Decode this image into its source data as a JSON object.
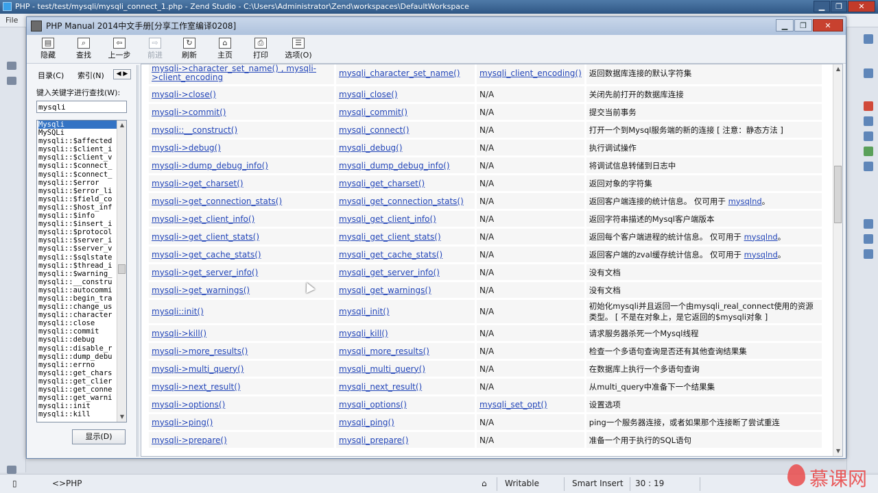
{
  "zend": {
    "title": "PHP - test/test/mysqli/mysqli_connect_1.php - Zend Studio - C:\\Users\\Administrator\\Zend\\workspaces\\DefaultWorkspace",
    "menu_first": "File",
    "status": {
      "editor": "PHP",
      "writable": "Writable",
      "insert_mode": "Smart Insert",
      "position": "30 : 19"
    }
  },
  "watermark": {
    "text": "慕课网"
  },
  "manual": {
    "title": "PHP Manual 2014中文手册[分享工作室编译0208]",
    "toolbar": [
      {
        "label": "隐藏",
        "icon": "hide-icon",
        "enabled": true
      },
      {
        "label": "查找",
        "icon": "find-icon",
        "enabled": true
      },
      {
        "label": "上一步",
        "icon": "back-icon",
        "enabled": true
      },
      {
        "label": "前进",
        "icon": "forward-icon",
        "enabled": false
      },
      {
        "label": "刷新",
        "icon": "refresh-icon",
        "enabled": true
      },
      {
        "label": "主页",
        "icon": "home-icon",
        "enabled": true
      },
      {
        "label": "打印",
        "icon": "print-icon",
        "enabled": true
      },
      {
        "label": "选项(O)",
        "icon": "options-icon",
        "enabled": true
      }
    ],
    "nav": {
      "tab_contents": "目录(C)",
      "tab_index": "索引(N)",
      "search_label": "键入关键字进行查找(W):",
      "search_value": "mysqli",
      "display_button": "显示(D)",
      "list": [
        "Mysqli",
        "MySQLi",
        "mysqli::$affected",
        "mysqli::$client_i",
        "mysqli::$client_v",
        "mysqli::$connect_",
        "mysqli::$connect_",
        "mysqli::$error",
        "mysqli::$error_li",
        "mysqli::$field_co",
        "mysqli::$host_inf",
        "mysqli::$info",
        "mysqli::$insert_i",
        "mysqli::$protocol",
        "mysqli::$server_i",
        "mysqli::$server_v",
        "mysqli::$sqlstate",
        "mysqli::$thread_i",
        "mysqli::$warning_",
        "mysqli::__constru",
        "mysqli::autocommi",
        "mysqli::begin_tra",
        "mysqli::change_us",
        "mysqli::character",
        "mysqli::close",
        "mysqli::commit",
        "mysqli::debug",
        "mysqli::disable_r",
        "mysqli::dump_debu",
        "mysqli::errno",
        "mysqli::get_chars",
        "mysqli::get_clier",
        "mysqli::get_conne",
        "mysqli::get_warni",
        "mysqli::init",
        "mysqli::kill"
      ]
    },
    "rows": [
      {
        "oop": "mysqli->character_set_name() , mysqli->client_encoding",
        "proc": "mysqli_character_set_name()",
        "alias": "mysqli_client_encoding()",
        "desc": "返回数据库连接的默认字符集",
        "tall": "first"
      },
      {
        "oop": "mysqli->close()",
        "proc": "mysqli_close()",
        "alias": "N/A",
        "desc": "关闭先前打开的数据库连接"
      },
      {
        "oop": "mysqli->commit()",
        "proc": "mysqli_commit()",
        "alias": "N/A",
        "desc": "提交当前事务"
      },
      {
        "oop": "mysqli::__construct()",
        "proc": "mysqli_connect()",
        "alias": "N/A",
        "desc": "打开一个到Mysql服务端的新的连接 [ 注意：静态方法 ]"
      },
      {
        "oop": "mysqli->debug()",
        "proc": "mysqli_debug()",
        "alias": "N/A",
        "desc": "执行调试操作"
      },
      {
        "oop": "mysqli->dump_debug_info()",
        "proc": "mysqli_dump_debug_info()",
        "alias": "N/A",
        "desc": "将调试信息转储到日志中"
      },
      {
        "oop": "mysqli->get_charset()",
        "proc": "mysqli_get_charset()",
        "alias": "N/A",
        "desc": "返回对象的字符集"
      },
      {
        "oop": "mysqli->get_connection_stats()",
        "proc": "mysqli_get_connection_stats()",
        "alias": "N/A",
        "desc": "返回客户端连接的统计信息。 仅可用于 ",
        "link": "mysqlnd",
        "after": "。"
      },
      {
        "oop": "mysqli->get_client_info()",
        "proc": "mysqli_get_client_info()",
        "alias": "N/A",
        "desc": "返回字符串描述的Mysql客户端版本"
      },
      {
        "oop": "mysqli->get_client_stats()",
        "proc": "mysqli_get_client_stats()",
        "alias": "N/A",
        "desc": "返回每个客户端进程的统计信息。 仅可用于 ",
        "link": "mysqlnd",
        "after": "。"
      },
      {
        "oop": "mysqli->get_cache_stats()",
        "proc": "mysqli_get_cache_stats()",
        "alias": "N/A",
        "desc": "返回客户端的zval缓存统计信息。 仅可用于 ",
        "link": "mysqlnd",
        "after": "。"
      },
      {
        "oop": "mysqli->get_server_info()",
        "proc": "mysqli_get_server_info()",
        "alias": "N/A",
        "desc": "没有文档"
      },
      {
        "oop": "mysqli->get_warnings()",
        "proc": "mysqli_get_warnings()",
        "alias": "N/A",
        "desc": "没有文档"
      },
      {
        "oop": "mysqli::init()",
        "proc": "mysqli_init()",
        "alias": "N/A",
        "desc": "初始化mysqli并且返回一个由mysqli_real_connect使用的资源类型。 [ 不是在对象上，是它返回的$mysqli对象 ]",
        "tall": "tall"
      },
      {
        "oop": "mysqli->kill()",
        "proc": "mysqli_kill()",
        "alias": "N/A",
        "desc": "请求服务器杀死一个Mysql线程"
      },
      {
        "oop": "mysqli->more_results()",
        "proc": "mysqli_more_results()",
        "alias": "N/A",
        "desc": "检查一个多语句查询是否还有其他查询结果集"
      },
      {
        "oop": "mysqli->multi_query()",
        "proc": "mysqli_multi_query()",
        "alias": "N/A",
        "desc": "在数据库上执行一个多语句查询"
      },
      {
        "oop": "mysqli->next_result()",
        "proc": "mysqli_next_result()",
        "alias": "N/A",
        "desc": "从multi_query中准备下一个结果集"
      },
      {
        "oop": "mysqli->options()",
        "proc": "mysqli_options()",
        "alias": "mysqli_set_opt()",
        "desc": "设置选项"
      },
      {
        "oop": "mysqli->ping()",
        "proc": "mysqli_ping()",
        "alias": "N/A",
        "desc": "ping一个服务器连接，或者如果那个连接断了尝试重连"
      },
      {
        "oop": "mysqli->prepare()",
        "proc": "mysqli_prepare()",
        "alias": "N/A",
        "desc": "准备一个用于执行的SQL语句"
      }
    ]
  }
}
